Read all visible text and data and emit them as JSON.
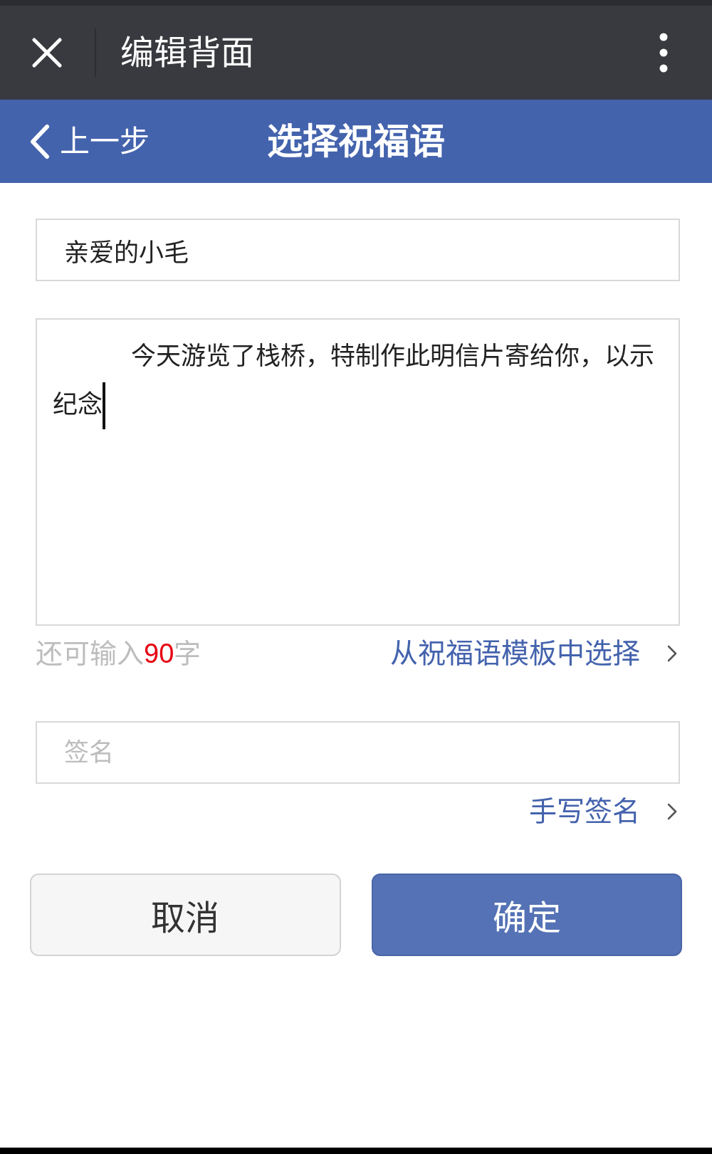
{
  "top_bar": {
    "title": "编辑背面"
  },
  "nav_bar": {
    "back_label": "上一步",
    "title": "选择祝福语"
  },
  "recipient_field": {
    "value": "亲爱的小毛"
  },
  "message_field": {
    "value": "今天游览了栈桥，特制作此明信片寄给你，以示纪念",
    "focused": true
  },
  "remaining_counter": {
    "prefix": "还可输入",
    "count": "90",
    "suffix": "字"
  },
  "template_link": {
    "label": "从祝福语模板中选择"
  },
  "signature_field": {
    "placeholder": "签名"
  },
  "handwriting_link": {
    "label": "手写签名"
  },
  "buttons": [
    {
      "label": "取消",
      "kind": "secondary"
    },
    {
      "label": "确定",
      "kind": "primary"
    }
  ]
}
